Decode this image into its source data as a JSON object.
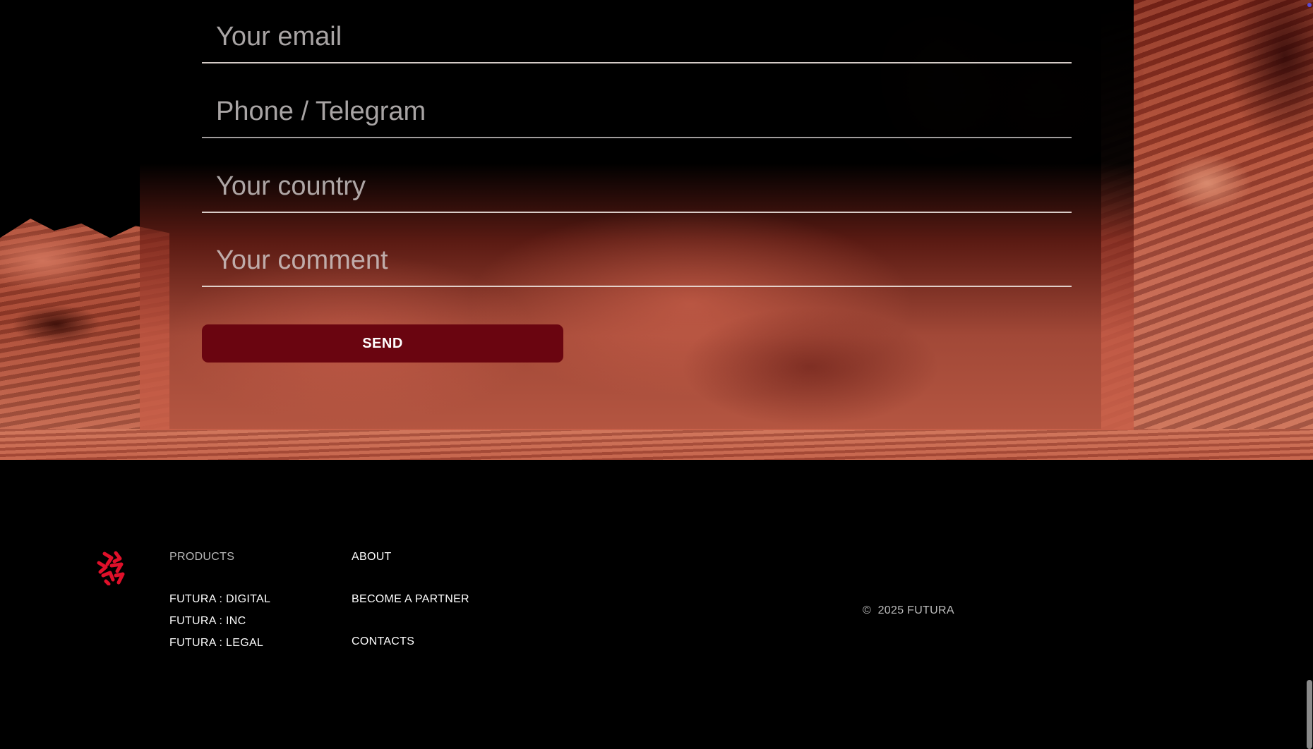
{
  "form": {
    "email_placeholder": "Your email",
    "phone_placeholder": "Phone / Telegram",
    "country_placeholder": "Your country",
    "comment_placeholder": "Your comment",
    "send_label": "SEND",
    "send_color": "#6a0510"
  },
  "footer": {
    "products": {
      "title": "PRODUCTS",
      "items": [
        "FUTURA : DIGITAL",
        "FUTURA : INC",
        "FUTURA : LEGAL"
      ]
    },
    "about": {
      "title": "ABOUT",
      "items": [
        "BECOME A PARTNER",
        "CONTACTS"
      ]
    },
    "copyright_symbol": "©",
    "copyright_text": "2025 FUTURA",
    "logo_icon": "futura-logo-icon",
    "logo_color": "#e0102a"
  }
}
